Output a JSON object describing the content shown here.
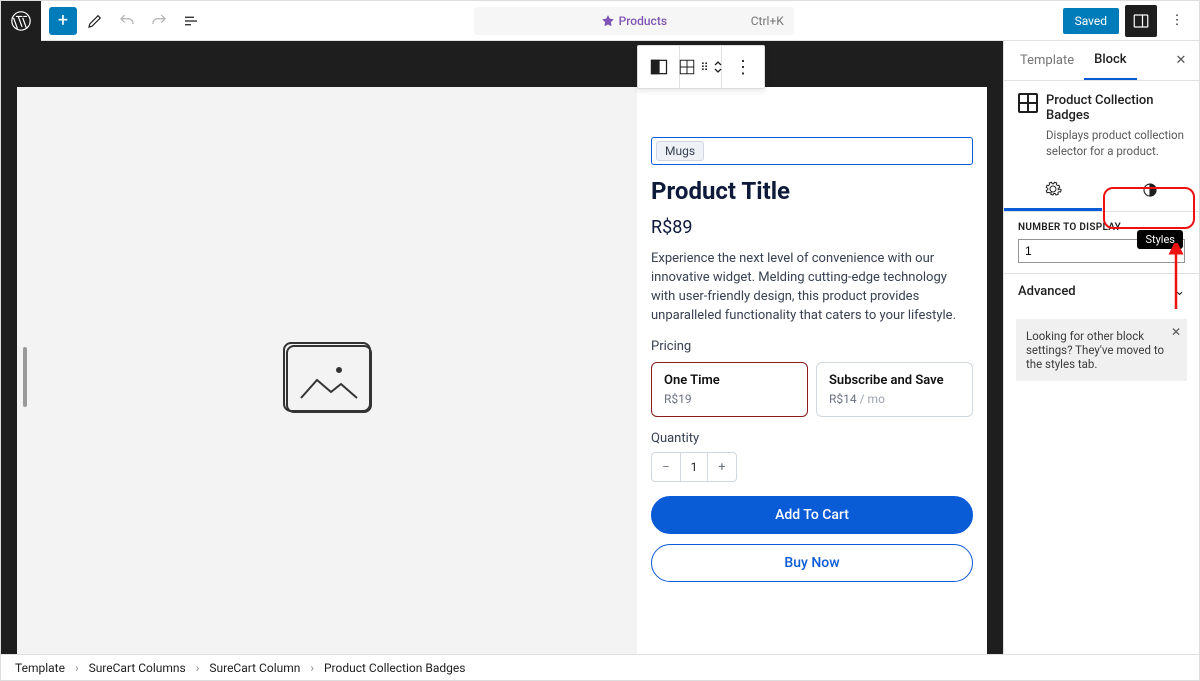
{
  "toolbar": {
    "center_label": "Products",
    "shortcut": "Ctrl+K",
    "saved": "Saved"
  },
  "breadcrumbs": [
    "Template",
    "SureCart Columns",
    "SureCart Column",
    "Product Collection Badges"
  ],
  "product": {
    "badge": "Mugs",
    "title": "Product Title",
    "price": "R$89",
    "description": "Experience the next level of convenience with our innovative widget. Melding cutting-edge technology with user-friendly design, this product provides unparalleled functionality that caters to your lifestyle.",
    "pricing_label": "Pricing",
    "options": [
      {
        "title": "One Time",
        "sub": "R$19",
        "unit": ""
      },
      {
        "title": "Subscribe and Save",
        "sub": "R$14",
        "unit": " / mo"
      }
    ],
    "quantity_label": "Quantity",
    "quantity_value": "1",
    "add_to_cart": "Add To Cart",
    "buy_now": "Buy Now"
  },
  "sidebar": {
    "tabs": {
      "template": "Template",
      "block": "Block"
    },
    "block_title": "Product Collection Badges",
    "block_desc": "Displays product collection selector for a product.",
    "number_label": "NUMBER TO DISPLAY",
    "number_value": "1",
    "advanced": "Advanced",
    "hint": "Looking for other block settings? They've moved to the styles tab.",
    "styles_tooltip": "Styles"
  }
}
